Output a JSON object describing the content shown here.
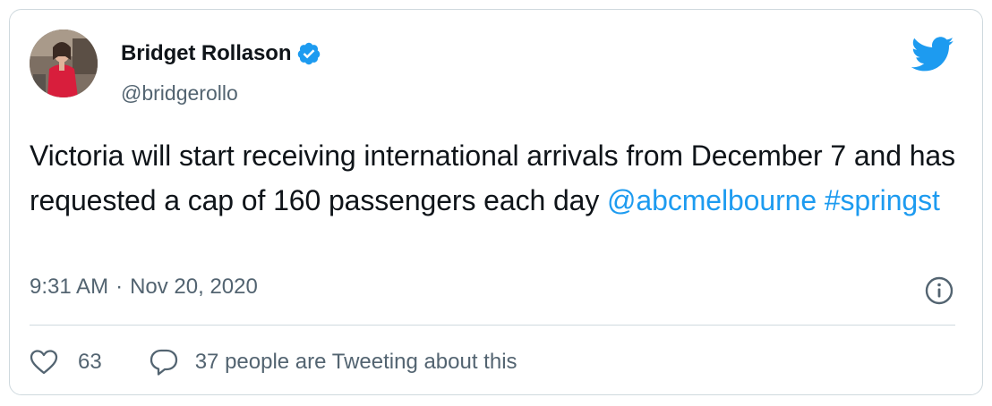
{
  "author": {
    "name": "Bridget Rollason",
    "handle": "@bridgerollo",
    "verified": true
  },
  "tweet": {
    "text_plain": "Victoria will start receiving international arrivals from December 7 and has requested a cap of 160 passengers each day ",
    "mention": "@abcmelbourne",
    "hashtag": "#springst",
    "time": "9:31 AM",
    "separator": "·",
    "date": "Nov 20, 2020"
  },
  "actions": {
    "like_count": "63",
    "conversation_label": "37 people are Tweeting about this"
  },
  "icons": {
    "brand": "twitter-bird-icon",
    "verified": "verified-badge-icon",
    "info": "info-icon",
    "like": "heart-icon",
    "reply": "speech-bubble-icon"
  },
  "colors": {
    "accent": "#1d9bf0",
    "text": "#0f1419",
    "secondary": "#536471",
    "border": "#cfd9de"
  }
}
